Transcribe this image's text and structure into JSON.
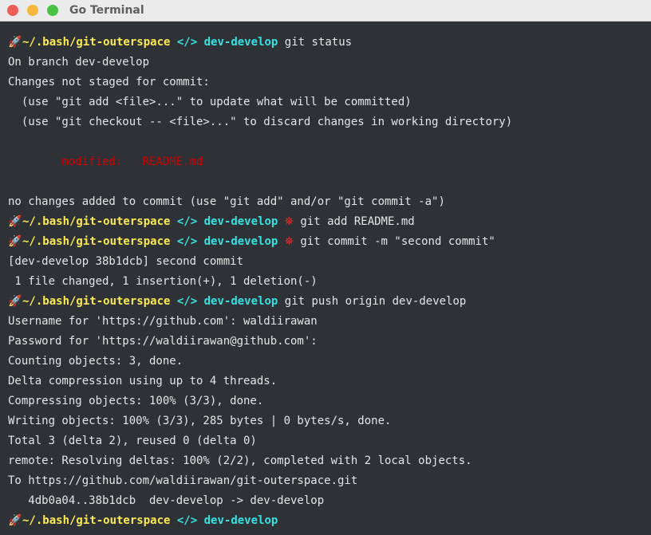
{
  "window": {
    "title": "Go Terminal"
  },
  "prompt": {
    "path": "~/.bash/git-outerspace",
    "branch": "dev-develop",
    "prompt_icon": "rocket-icon",
    "code_icon": "</>",
    "dirty_icon": "⛯",
    "colors": {
      "path": "#fce94f",
      "branch": "#34e2e2",
      "icon": "#8ae234",
      "dirty": "#ef2929"
    }
  },
  "lines": {
    "l1_cmd": "git status",
    "l2": "On branch dev-develop",
    "l3": "Changes not staged for commit:",
    "l4": "  (use \"git add <file>...\" to update what will be committed)",
    "l5": "  (use \"git checkout -- <file>...\" to discard changes in working directory)",
    "l7": "        modified:   README.md",
    "l9": "no changes added to commit (use \"git add\" and/or \"git commit -a\")",
    "l10_cmd": "git add README.md",
    "l11_cmd": "git commit -m \"second commit\"",
    "l12": "[dev-develop 38b1dcb] second commit",
    "l13": " 1 file changed, 1 insertion(+), 1 deletion(-)",
    "l14_cmd": "git push origin dev-develop",
    "l15": "Username for 'https://github.com': waldiirawan",
    "l16": "Password for 'https://waldiirawan@github.com':",
    "l17": "Counting objects: 3, done.",
    "l18": "Delta compression using up to 4 threads.",
    "l19": "Compressing objects: 100% (3/3), done.",
    "l20": "Writing objects: 100% (3/3), 285 bytes | 0 bytes/s, done.",
    "l21": "Total 3 (delta 2), reused 0 (delta 0)",
    "l22": "remote: Resolving deltas: 100% (2/2), completed with 2 local objects.",
    "l23": "To https://github.com/waldiirawan/git-outerspace.git",
    "l24": "   4db0a04..38b1dcb  dev-develop -> dev-develop"
  }
}
